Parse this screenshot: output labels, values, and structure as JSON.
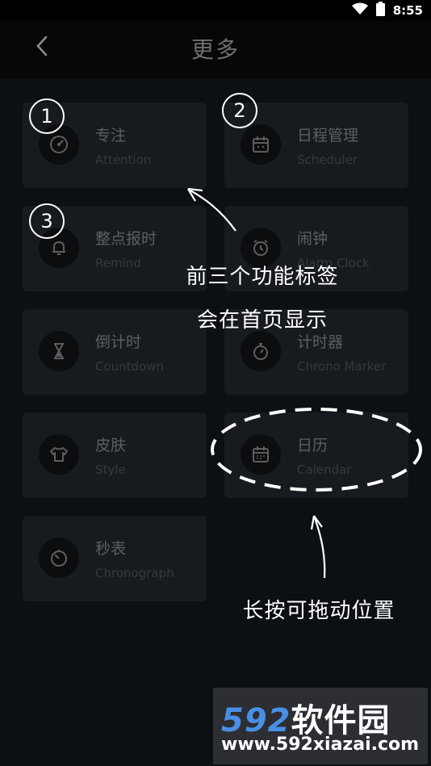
{
  "status": {
    "time": "8:55"
  },
  "header": {
    "title": "更多"
  },
  "cards": [
    {
      "title": "专注",
      "subtitle": "Attention",
      "icon": "gauge-icon"
    },
    {
      "title": "日程管理",
      "subtitle": "Scheduler",
      "icon": "calendar-icon"
    },
    {
      "title": "整点报时",
      "subtitle": "Remind",
      "icon": "bell-icon"
    },
    {
      "title": "闹钟",
      "subtitle": "Alarm Clock",
      "icon": "alarm-clock-icon"
    },
    {
      "title": "倒计时",
      "subtitle": "Countdown",
      "icon": "hourglass-icon"
    },
    {
      "title": "计时器",
      "subtitle": "Chrono Marker",
      "icon": "stopwatch-icon"
    },
    {
      "title": "皮肤",
      "subtitle": "Style",
      "icon": "shirt-icon"
    },
    {
      "title": "日历",
      "subtitle": "Calendar",
      "icon": "calendar-grid-icon"
    },
    {
      "title": "秒表",
      "subtitle": "Chronograph",
      "icon": "timer-icon"
    }
  ],
  "annotations": {
    "badges": [
      "1",
      "2",
      "3"
    ],
    "note_first_line1": "前三个功能标签",
    "note_first_line2": "会在首页显示",
    "note_drag": "长按可拖动位置"
  },
  "watermark": {
    "logo_num": "592",
    "logo_text": "软件园",
    "url": "www.592xiazai.com"
  }
}
